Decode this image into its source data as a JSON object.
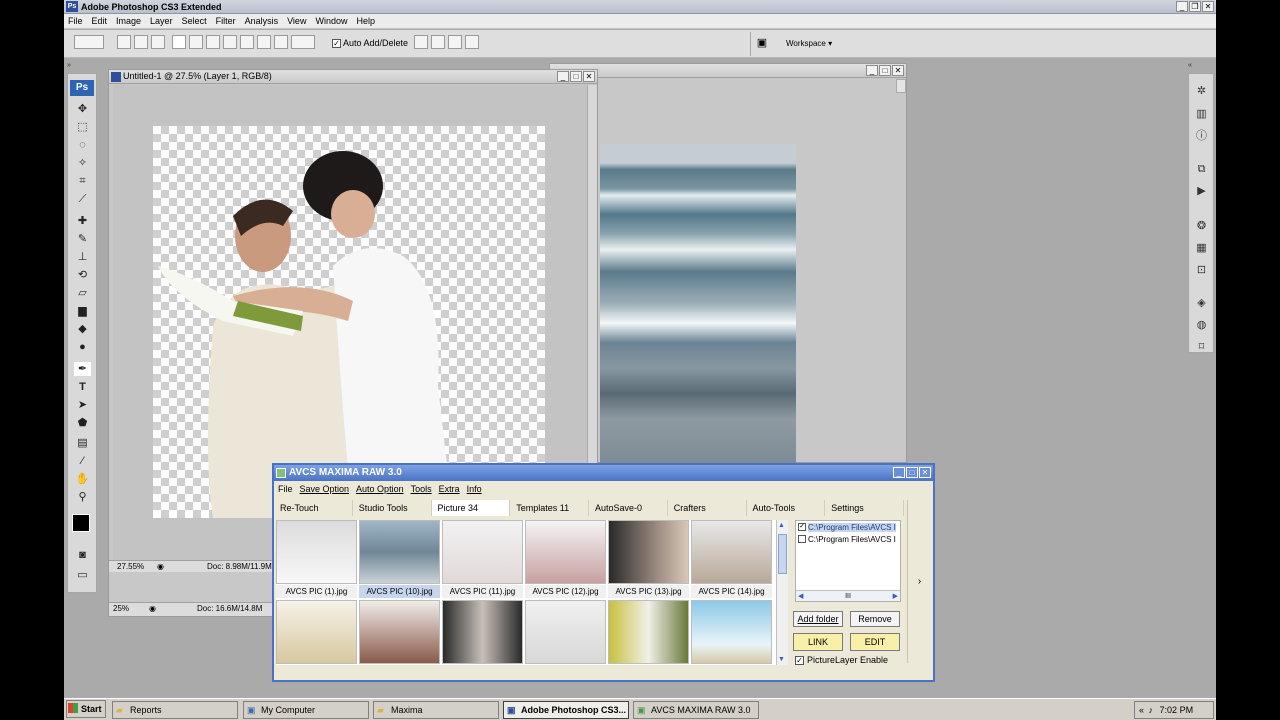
{
  "app": {
    "title": "Adobe Photoshop CS3 Extended",
    "logo": "Ps"
  },
  "menu": [
    "File",
    "Edit",
    "Image",
    "Layer",
    "Select",
    "Filter",
    "Analysis",
    "View",
    "Window",
    "Help"
  ],
  "options": {
    "auto_add_delete": "Auto Add/Delete",
    "workspace": "Workspace ▾"
  },
  "doc1": {
    "title": "Untitled-1 @ 27.5% (Layer 1, RGB/8)",
    "zoom": "27.55%",
    "docsize": "Doc: 8.98M/11.9M"
  },
  "doc2": {
    "zoom": "25%",
    "docsize": "Doc: 16.6M/14.8M"
  },
  "avcs": {
    "title": "AVCS MAXIMA RAW 3.0",
    "menu": [
      "File",
      "Save Option",
      "Auto Option",
      "Tools",
      "Extra",
      "Info"
    ],
    "tabs": [
      "Re-Touch",
      "Studio Tools",
      "Picture 34",
      "Templates 11",
      "AutoSave-0",
      "Crafters",
      "Auto-Tools",
      "Settings"
    ],
    "thumbs": [
      "AVCS PIC (1).jpg",
      "AVCS PIC (10).jpg",
      "AVCS PIC (11).jpg",
      "AVCS PIC (12).jpg",
      "AVCS PIC (13).jpg",
      "AVCS PIC (14).jpg"
    ],
    "folders": [
      "C:\\Program Files\\AVCS I",
      "C:\\Program Files\\AVCS I"
    ],
    "hscroll": "III",
    "add_folder": "Add folder",
    "remove": "Remove",
    "link": "LINK",
    "edit": "EDIT",
    "picture_layer": "PictureLayer Enable"
  },
  "taskbar": {
    "start": "Start",
    "items": [
      "Reports",
      "My Computer",
      "Maxima",
      "Adobe Photoshop CS3...",
      "AVCS MAXIMA RAW 3.0"
    ],
    "time": "7:02 PM"
  }
}
